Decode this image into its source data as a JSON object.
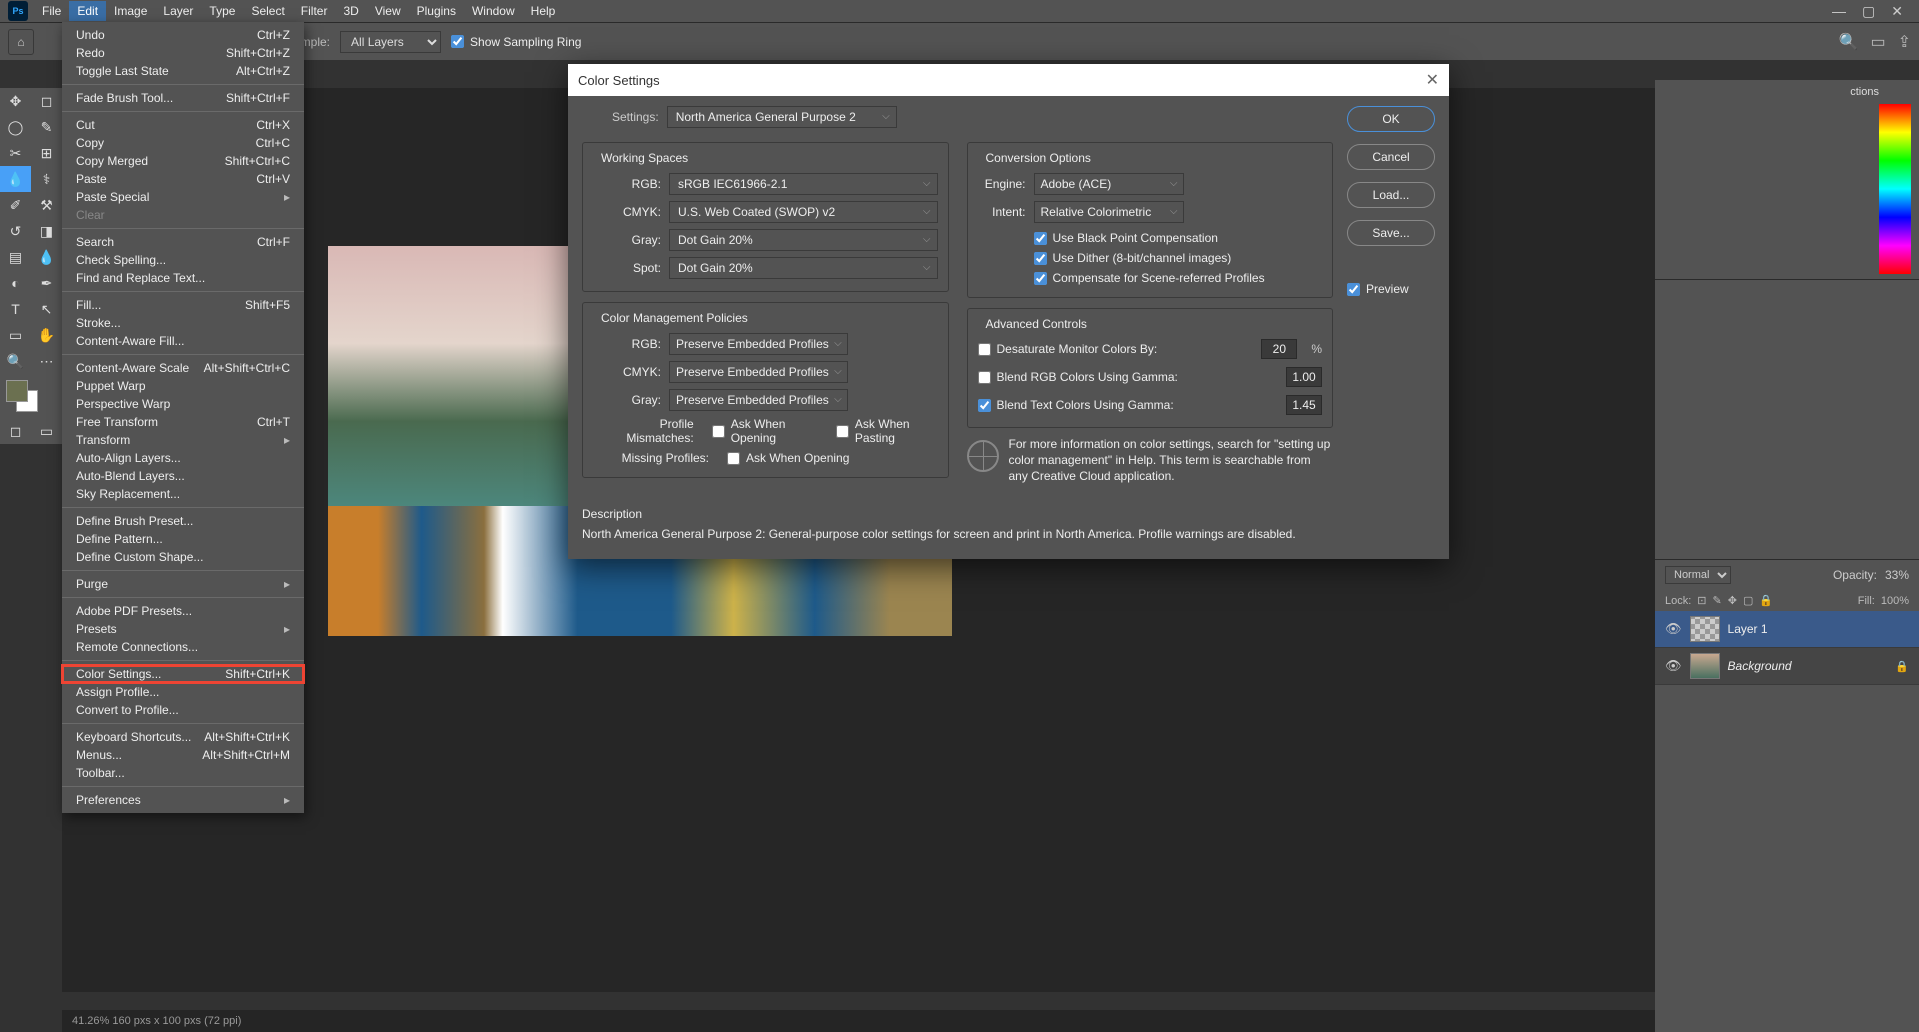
{
  "menubar": [
    "File",
    "Edit",
    "Image",
    "Layer",
    "Type",
    "Select",
    "Filter",
    "3D",
    "View",
    "Plugins",
    "Window",
    "Help"
  ],
  "menubar_active": "Edit",
  "options": {
    "sample_label": "ample:",
    "sample_value": "All Layers",
    "sampling_ring": "Show Sampling Ring"
  },
  "edit_menu": [
    {
      "label": "Undo",
      "shortcut": "Ctrl+Z"
    },
    {
      "label": "Redo",
      "shortcut": "Shift+Ctrl+Z"
    },
    {
      "label": "Toggle Last State",
      "shortcut": "Alt+Ctrl+Z"
    },
    {
      "sep": true
    },
    {
      "label": "Fade Brush Tool...",
      "shortcut": "Shift+Ctrl+F"
    },
    {
      "sep": true
    },
    {
      "label": "Cut",
      "shortcut": "Ctrl+X"
    },
    {
      "label": "Copy",
      "shortcut": "Ctrl+C"
    },
    {
      "label": "Copy Merged",
      "shortcut": "Shift+Ctrl+C"
    },
    {
      "label": "Paste",
      "shortcut": "Ctrl+V"
    },
    {
      "label": "Paste Special",
      "submenu": true
    },
    {
      "label": "Clear",
      "disabled": true
    },
    {
      "sep": true
    },
    {
      "label": "Search",
      "shortcut": "Ctrl+F"
    },
    {
      "label": "Check Spelling..."
    },
    {
      "label": "Find and Replace Text..."
    },
    {
      "sep": true
    },
    {
      "label": "Fill...",
      "shortcut": "Shift+F5"
    },
    {
      "label": "Stroke..."
    },
    {
      "label": "Content-Aware Fill..."
    },
    {
      "sep": true
    },
    {
      "label": "Content-Aware Scale",
      "shortcut": "Alt+Shift+Ctrl+C"
    },
    {
      "label": "Puppet Warp"
    },
    {
      "label": "Perspective Warp"
    },
    {
      "label": "Free Transform",
      "shortcut": "Ctrl+T"
    },
    {
      "label": "Transform",
      "submenu": true
    },
    {
      "label": "Auto-Align Layers..."
    },
    {
      "label": "Auto-Blend Layers..."
    },
    {
      "label": "Sky Replacement..."
    },
    {
      "sep": true
    },
    {
      "label": "Define Brush Preset..."
    },
    {
      "label": "Define Pattern..."
    },
    {
      "label": "Define Custom Shape..."
    },
    {
      "sep": true
    },
    {
      "label": "Purge",
      "submenu": true
    },
    {
      "sep": true
    },
    {
      "label": "Adobe PDF Presets..."
    },
    {
      "label": "Presets",
      "submenu": true
    },
    {
      "label": "Remote Connections..."
    },
    {
      "sep": true
    },
    {
      "label": "Color Settings...",
      "shortcut": "Shift+Ctrl+K",
      "highlight": true
    },
    {
      "label": "Assign Profile..."
    },
    {
      "label": "Convert to Profile..."
    },
    {
      "sep": true
    },
    {
      "label": "Keyboard Shortcuts...",
      "shortcut": "Alt+Shift+Ctrl+K"
    },
    {
      "label": "Menus...",
      "shortcut": "Alt+Shift+Ctrl+M"
    },
    {
      "label": "Toolbar..."
    },
    {
      "sep": true
    },
    {
      "label": "Preferences",
      "submenu": true
    }
  ],
  "dialog": {
    "title": "Color Settings",
    "settings_label": "Settings:",
    "settings_value": "North America General Purpose 2",
    "working_spaces": "Working Spaces",
    "rgb_lbl": "RGB:",
    "rgb_val": "sRGB IEC61966-2.1",
    "cmyk_lbl": "CMYK:",
    "cmyk_val": "U.S. Web Coated (SWOP) v2",
    "gray_lbl": "Gray:",
    "gray_val": "Dot Gain 20%",
    "spot_lbl": "Spot:",
    "spot_val": "Dot Gain 20%",
    "policies": "Color Management Policies",
    "p_rgb": "Preserve Embedded Profiles",
    "p_cmyk": "Preserve Embedded Profiles",
    "p_gray": "Preserve Embedded Profiles",
    "mismatch_lbl": "Profile Mismatches:",
    "ask_open": "Ask When Opening",
    "ask_paste": "Ask When Pasting",
    "missing_lbl": "Missing Profiles:",
    "conv": "Conversion Options",
    "engine_lbl": "Engine:",
    "engine_val": "Adobe (ACE)",
    "intent_lbl": "Intent:",
    "intent_val": "Relative Colorimetric",
    "bpc": "Use Black Point Compensation",
    "dither": "Use Dither (8-bit/channel images)",
    "compensate": "Compensate for Scene-referred Profiles",
    "adv": "Advanced Controls",
    "desat": "Desaturate Monitor Colors By:",
    "desat_val": "20",
    "pct": "%",
    "blend_rgb": "Blend RGB Colors Using Gamma:",
    "blend_rgb_val": "1.00",
    "blend_txt": "Blend Text Colors Using Gamma:",
    "blend_txt_val": "1.45",
    "info": "For more information on color settings, search for \"setting up color management\" in Help. This term is searchable from any Creative Cloud application.",
    "desc_t": "Description",
    "desc_d": "North America General Purpose 2:   General-purpose color settings for screen and print in North America. Profile warnings are disabled.",
    "btn_ok": "OK",
    "btn_cancel": "Cancel",
    "btn_load": "Load...",
    "btn_save": "Save...",
    "btn_preview": "Preview"
  },
  "panels": {
    "color_tab": "ctions",
    "normal": "Normal",
    "opacity_lbl": "Opacity:",
    "opacity_val": "33%",
    "lock_lbl": "Lock:",
    "fill_lbl": "Fill:",
    "fill_val": "100%",
    "layer1": "Layer 1",
    "bg": "Background"
  },
  "status": "41.26%    160 pxs x 100 pxs (72 ppi)"
}
